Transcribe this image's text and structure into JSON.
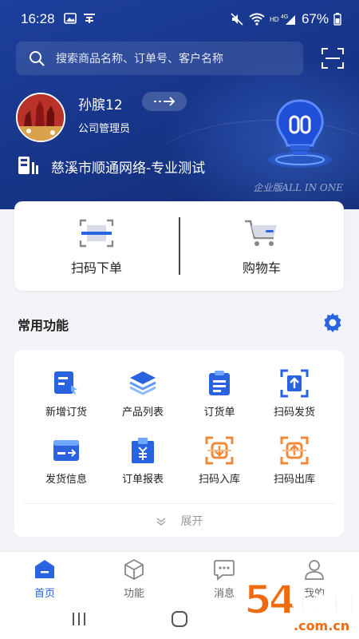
{
  "status": {
    "time": "16:28",
    "battery": "67%",
    "network": "HD 4G"
  },
  "search": {
    "placeholder": "搜索商品名称、订单号、客户名称"
  },
  "profile": {
    "name": "孙膑12",
    "role": "公司管理员",
    "company": "慈溪市顺通网络-专业测试",
    "edition": "企业版ALL IN ONE"
  },
  "quick_actions": [
    {
      "label": "扫码下单",
      "icon": "scan-barcode-icon"
    },
    {
      "label": "购物车",
      "icon": "shopping-cart-icon"
    }
  ],
  "common": {
    "title": "常用功能",
    "items": [
      {
        "label": "新增订货",
        "icon": "new-order-icon"
      },
      {
        "label": "产品列表",
        "icon": "product-list-icon"
      },
      {
        "label": "订货单",
        "icon": "order-sheet-icon"
      },
      {
        "label": "扫码发货",
        "icon": "scan-ship-icon"
      },
      {
        "label": "发货信息",
        "icon": "shipping-info-icon"
      },
      {
        "label": "订单报表",
        "icon": "order-report-icon"
      },
      {
        "label": "扫码入库",
        "icon": "scan-inbound-icon"
      },
      {
        "label": "扫码出库",
        "icon": "scan-outbound-icon"
      }
    ],
    "expand_label": "展开"
  },
  "tabs": [
    {
      "label": "首页",
      "active": true
    },
    {
      "label": "功能",
      "active": false
    },
    {
      "label": "消息",
      "active": false
    },
    {
      "label": "我的",
      "active": false
    }
  ],
  "watermark": {
    "number": "54",
    "text": "手游网",
    "url": ".com.cn"
  },
  "colors": {
    "primary": "#2a63e0",
    "header": "#1a3a95",
    "accent_orange": "#f08a3a"
  }
}
